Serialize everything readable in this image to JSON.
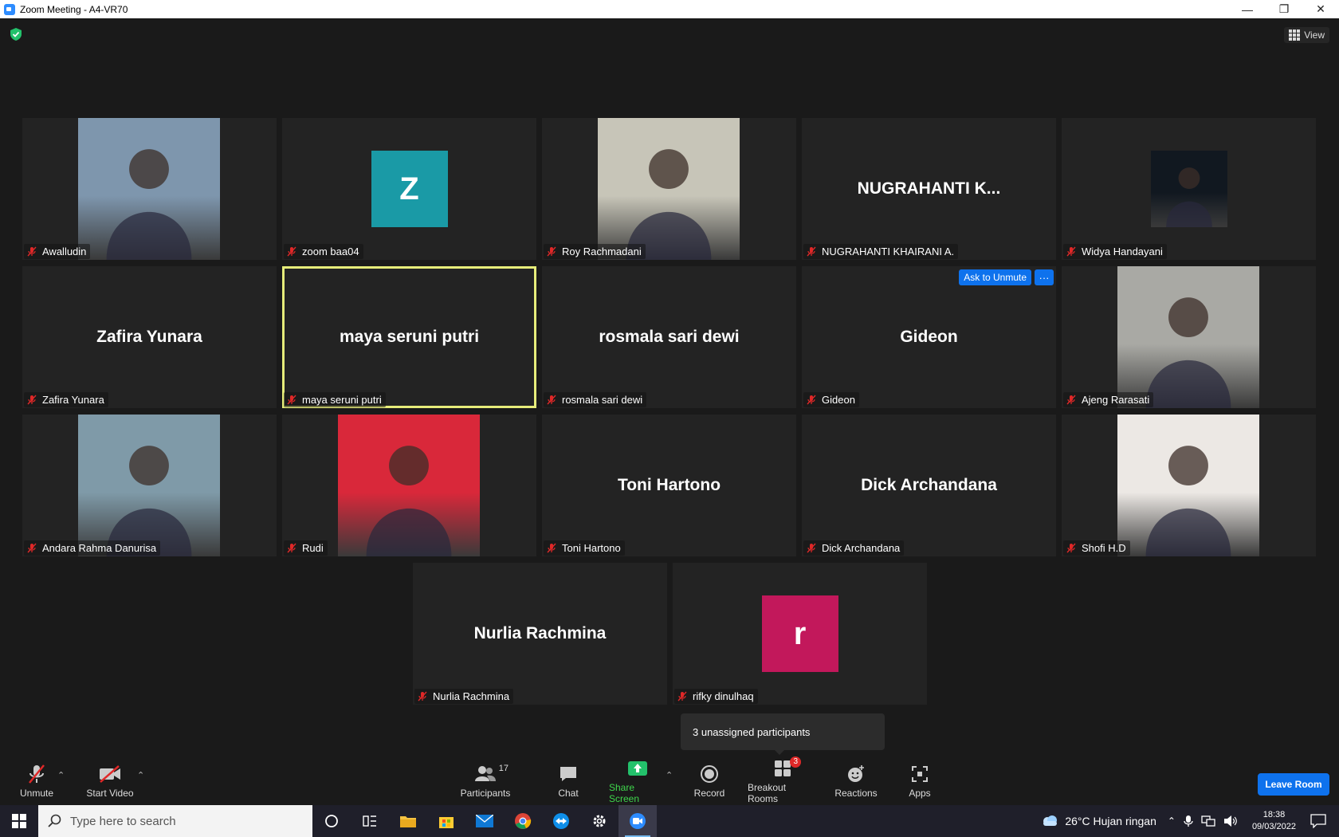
{
  "window": {
    "title": "Zoom Meeting - A4-VR70",
    "minimize": "—",
    "restore": "❐",
    "close": "✕"
  },
  "view_label": "View",
  "tiles": [
    {
      "name": "Awalludin",
      "center": "",
      "kind": "photo",
      "color": "#7e96ad"
    },
    {
      "name": "zoom baa04",
      "center": "Z",
      "kind": "avatar",
      "color": "#1a9aa6"
    },
    {
      "name": "Roy Rachmadani",
      "center": "",
      "kind": "photo",
      "color": "#c7c5b8"
    },
    {
      "name": "NUGRAHANTI KHAIRANI A.",
      "center": "NUGRAHANTI  K...",
      "kind": "text"
    },
    {
      "name": "Widya Handayani",
      "center": "",
      "kind": "photo",
      "color": "#111820"
    },
    {
      "name": "Zafira Yunara",
      "center": "Zafira Yunara",
      "kind": "text"
    },
    {
      "name": "maya seruni putri",
      "center": "maya seruni putri",
      "kind": "text"
    },
    {
      "name": "rosmala sari dewi",
      "center": "rosmala sari dewi",
      "kind": "text"
    },
    {
      "name": "Gideon",
      "center": "Gideon",
      "kind": "text"
    },
    {
      "name": "Ajeng Rarasati",
      "center": "",
      "kind": "photo",
      "color": "#a9a9a4"
    },
    {
      "name": "Andara Rahma Danurisa",
      "center": "",
      "kind": "photo",
      "color": "#7f9aa8"
    },
    {
      "name": "Rudi",
      "center": "",
      "kind": "photo",
      "color": "#d9283a"
    },
    {
      "name": "Toni Hartono",
      "center": "Toni Hartono",
      "kind": "text"
    },
    {
      "name": "Dick Archandana",
      "center": "Dick Archandana",
      "kind": "text"
    },
    {
      "name": "Shofi H.D",
      "center": "",
      "kind": "photo",
      "color": "#ece8e4"
    },
    {
      "name": "Nurlia Rachmina",
      "center": "Nurlia Rachmina",
      "kind": "text"
    },
    {
      "name": "rifky dinulhaq",
      "center": "r",
      "kind": "avatar",
      "color": "#c2185b"
    }
  ],
  "gideon_actions": {
    "ask_unmute": "Ask to Unmute",
    "more": "···"
  },
  "tooltip": "3 unassigned participants",
  "toolbar": {
    "unmute": "Unmute",
    "start_video": "Start Video",
    "participants": "Participants",
    "participants_count": "17",
    "chat": "Chat",
    "share_screen": "Share Screen",
    "record": "Record",
    "breakout_rooms": "Breakout Rooms",
    "breakout_badge": "3",
    "reactions": "Reactions",
    "apps": "Apps",
    "leave_room": "Leave Room",
    "caret": "⌃"
  },
  "taskbar": {
    "search_placeholder": "Type here to search",
    "weather": "26°C  Hujan ringan",
    "time": "18:38",
    "date": "09/03/2022"
  },
  "colors": {
    "accent_blue": "#0e72ed",
    "active_speaker_border": "#e6ec7a",
    "share_green": "#3fd64c",
    "mute_red": "#e02828"
  }
}
